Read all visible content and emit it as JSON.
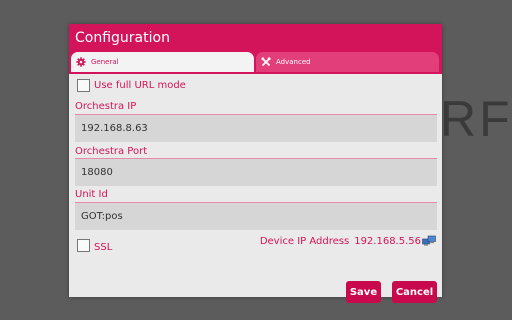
{
  "background": {
    "brand_fragment": "RFI"
  },
  "dialog": {
    "title": "Configuration",
    "tabs": [
      {
        "label": "General",
        "icon": "gear-icon",
        "selected": true
      },
      {
        "label": "Advanced",
        "icon": "tools-icon",
        "selected": false
      }
    ],
    "full_url_mode": {
      "label": "Use full URL mode",
      "checked": false
    },
    "orchestra_ip": {
      "label": "Orchestra IP",
      "value": "192.168.8.63"
    },
    "orchestra_port": {
      "label": "Orchestra Port",
      "value": "18080"
    },
    "unit_id": {
      "label": "Unit Id",
      "value": "GOT:pos"
    },
    "ssl": {
      "label": "SSL",
      "checked": false
    },
    "device_ip": {
      "label": "Device IP Address",
      "value": "192.168.5.56",
      "icon": "network-icon"
    },
    "buttons": {
      "save": "Save",
      "cancel": "Cancel"
    }
  },
  "colors": {
    "accent": "#d4145a",
    "tab_inactive": "#e23e79",
    "button": "#c9094e",
    "backdrop": "#5c5c5c"
  }
}
